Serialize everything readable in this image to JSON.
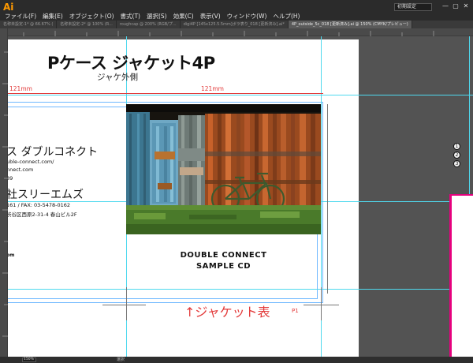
{
  "app": {
    "logo_text": "Ai",
    "workspace_label": "初期設定",
    "menu": [
      "ファイル(F)",
      "編集(E)",
      "オブジェクト(O)",
      "書式(T)",
      "選択(S)",
      "効果(C)",
      "表示(V)",
      "ウィンドウ(W)",
      "ヘルプ(H)"
    ],
    "window_controls": [
      "—",
      "▢",
      "✕"
    ]
  },
  "tabs": [
    {
      "label": "名称未設定-1* @ 66.67% (",
      "active": false
    },
    {
      "label": "名称未設定-2* @ 100% (R...",
      "active": false
    },
    {
      "label": "roughcap @ 200% (RGB/プ...",
      "active": false
    },
    {
      "label": "digi4P [145x125.5.5mm]ボラ表り_018 [更新済み].ai*",
      "active": false
    },
    {
      "label": "4P_outside_5c_018 [更新済み].ai @ 150% (CMYK/プレビュー)",
      "active": true
    }
  ],
  "document": {
    "title": "Pケース ジャケット4P",
    "subtitle": "ジャケ外側",
    "measure_left": "121mm",
    "measure_right": "121mm",
    "cd_title": "DOUBLE CONNECT",
    "cd_subtitle": "SAMPLE CD",
    "brand1_name": "ス ダブルコネクト",
    "brand1_url": "uble-connect.com/",
    "brand1_url2": "nnect.com",
    "brand1_tel": "89",
    "brand2_name": "社スリーエムズ",
    "brand2_tel": "161 / FAX: 03-5478-0162",
    "brand2_addr": "渋谷区西原2-31-4 春山ビル2F",
    "small_label": "om",
    "jacket_label": "↑ジャケット表",
    "page_label": "P1"
  },
  "right_panel": {
    "markers": [
      "1",
      "2",
      "3"
    ]
  },
  "status": {
    "zoom": "150%",
    "tool": "選択"
  },
  "colors": {
    "guide": "#4fd9ee",
    "measure_red": "#e33a3a",
    "magenta": "#e6007e",
    "illustrator_orange": "#ff9a00"
  }
}
